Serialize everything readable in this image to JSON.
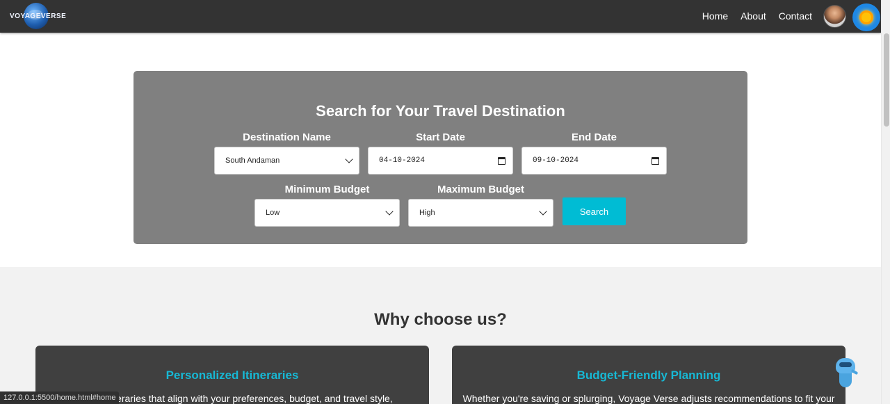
{
  "nav": {
    "logo_text_a": "VOY",
    "logo_text_b": "AGE",
    "logo_text_c": "VERSE",
    "links": [
      "Home",
      "About",
      "Contact"
    ]
  },
  "search": {
    "title": "Search for Your Travel Destination",
    "destination_label": "Destination Name",
    "destination_value": "South Andaman",
    "start_label": "Start Date",
    "start_value": "04-10-2024",
    "end_label": "End Date",
    "end_value": "09-10-2024",
    "min_budget_label": "Minimum Budget",
    "min_budget_value": "Low",
    "max_budget_label": "Maximum Budget",
    "max_budget_value": "High",
    "button_label": "Search"
  },
  "why": {
    "title": "Why choose us?",
    "cards": [
      {
        "title": "Personalized Itineraries",
        "text": "…ored itineraries that align with your preferences, budget, and travel style,"
      },
      {
        "title": "Budget-Friendly Planning",
        "text": "Whether you're saving or splurging, Voyage Verse adjusts recommendations to fit your"
      }
    ]
  },
  "status_url": "127.0.0.1:5500/home.html#home",
  "colors": {
    "navbar": "#333333",
    "panel": "#808080",
    "accent": "#00bcd4",
    "card": "#404040",
    "card_title": "#17b8d4"
  }
}
